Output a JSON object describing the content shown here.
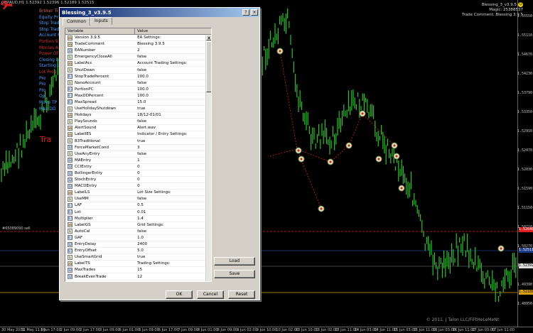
{
  "chart": {
    "symbol_header": "GBPAUD,H1  1.52392 1.52396 1.52189 1.52515",
    "ea_info": [
      "Blessing_3_v3.9.5",
      "Magic:   25388537",
      "Trade Comment: Blessing 3.9.5"
    ],
    "ticket_label": "#65089090 sell",
    "copyright": "© 2011, J Talon LLC/FiFtHeLeMeNt",
    "overlay_lines": [
      {
        "text": "Broker Ti",
        "color": "#d06060"
      },
      {
        "text": "Equity Pr",
        "color": "#40a0ff"
      },
      {
        "text": "Stop Trad",
        "color": "#40a0ff"
      },
      {
        "text": "Stop Trad",
        "color": "#40a0ff"
      },
      {
        "text": "Account P",
        "color": "#40a0ff"
      },
      {
        "text": "Portion B",
        "color": "#d03030"
      },
      {
        "text": "Monies A",
        "color": "#d03030"
      },
      {
        "text": "Power Of",
        "color": "#d03030"
      },
      {
        "text": "Closing Le",
        "color": "#40a0ff"
      },
      {
        "text": "Starting L",
        "color": "#40a0ff"
      },
      {
        "text": "Lot Prog",
        "color": "#d03030"
      },
      {
        "text": "Pro",
        "color": "#40a0ff"
      },
      {
        "text": "Pro",
        "color": "#40a0ff"
      },
      {
        "text": "Pro",
        "color": "#40a0ff"
      },
      {
        "text": "Op",
        "color": "#40a0ff"
      },
      {
        "text": "Move TP",
        "color": "#40a0ff"
      },
      {
        "text": "Max DD",
        "color": "#40a0ff"
      }
    ],
    "overlay_big": "Tra",
    "price_labels": [
      "1.55550",
      "1.55110",
      "1.54670",
      "1.54230",
      "1.53790",
      "1.53350",
      "1.52910",
      "1.52470",
      "1.52030",
      "1.51590",
      "1.51150",
      "1.50710",
      "1.50270",
      "1.49830",
      "1.49390",
      "1.48950"
    ],
    "price_tags": [
      {
        "text": "1.52640",
        "color": "#e02020",
        "fg": "#fff"
      },
      {
        "text": "1.52511",
        "color": "#1c3a8a",
        "fg": "#fff"
      },
      {
        "text": "1.52392",
        "color": "#dddddd",
        "fg": "#000"
      },
      {
        "text": "1.52189",
        "color": "#d6a010",
        "fg": "#000"
      }
    ],
    "time_labels": [
      "30 May 2011",
      "31 May 11:00",
      "1 Jun 17:00",
      "2 Jun 09:00",
      "2 Jun 17:00",
      "3 Jun 09:00",
      "6 Jun 01:00",
      "6 Jun 09:00",
      "6 Jun 17:00",
      "7 Jun 09:00",
      "8 Jun 01:00",
      "8 Jun 09:00",
      "9 Jun 02:00",
      "9 Jun 10:00",
      "10 Jun 02:00",
      "10 Jun 10:00",
      "13 Jun 02:00",
      "13 Jun 11:00",
      "14 Jun 03:00",
      "14 Jun 11:00",
      "15 Jun 03:00",
      "15 Jun 11:00",
      "16 Jun 03:00",
      "16 Jun 11:00",
      "17 Jun 03:00",
      "17 Jun 11:00"
    ]
  },
  "dialog": {
    "title": "Blessing_3_v3.9.5",
    "tabs": [
      "Common",
      "Inputs"
    ],
    "active_tab": 1,
    "columns": [
      "Variable",
      "Value"
    ],
    "rows": [
      {
        "name": "Version 3.9.5",
        "value": "EA Settings:",
        "type": "str"
      },
      {
        "name": "TradeComment",
        "value": "Blessing 3.9.5",
        "type": "str"
      },
      {
        "name": "EANumber",
        "value": "2",
        "type": "int"
      },
      {
        "name": "EmergencyCloseAll",
        "value": "false",
        "type": "bool"
      },
      {
        "name": "LabelAcc",
        "value": "Account Trading Settings:",
        "type": "str"
      },
      {
        "name": "ShutDown",
        "value": "false",
        "type": "bool"
      },
      {
        "name": "StopTradePercent",
        "value": "100.0",
        "type": "dbl"
      },
      {
        "name": "NanoAccount",
        "value": "false",
        "type": "bool"
      },
      {
        "name": "PortionPC",
        "value": "100.0",
        "type": "dbl"
      },
      {
        "name": "MaxDDPercent",
        "value": "100.0",
        "type": "dbl"
      },
      {
        "name": "MaxSpread",
        "value": "15.0",
        "type": "dbl"
      },
      {
        "name": "UseHolidayShutdown",
        "value": "true",
        "type": "bool"
      },
      {
        "name": "Holidays",
        "value": "18/12-01/01",
        "type": "str"
      },
      {
        "name": "PlaySounds",
        "value": "false",
        "type": "bool"
      },
      {
        "name": "AlertSound",
        "value": "Alert.wav",
        "type": "str"
      },
      {
        "name": "LabelIES",
        "value": "Indicator / Entry Settings:",
        "type": "str"
      },
      {
        "name": "B3Traditional",
        "value": "true",
        "type": "bool"
      },
      {
        "name": "ForceMarketCond",
        "value": "3",
        "type": "int"
      },
      {
        "name": "UseAnyEntry",
        "value": "false",
        "type": "bool"
      },
      {
        "name": "MAEntry",
        "value": "1",
        "type": "int"
      },
      {
        "name": "CCIEntry",
        "value": "0",
        "type": "int"
      },
      {
        "name": "BollingerEntry",
        "value": "0",
        "type": "int"
      },
      {
        "name": "StochEntry",
        "value": "0",
        "type": "int"
      },
      {
        "name": "MACDEntry",
        "value": "0",
        "type": "int"
      },
      {
        "name": "LabelLS",
        "value": "Lot Size Settings:",
        "type": "str"
      },
      {
        "name": "UseMM",
        "value": "false",
        "type": "bool"
      },
      {
        "name": "LAF",
        "value": "0.5",
        "type": "dbl"
      },
      {
        "name": "Lot",
        "value": "0.01",
        "type": "dbl"
      },
      {
        "name": "Multiplier",
        "value": "1.4",
        "type": "dbl"
      },
      {
        "name": "LabelGS",
        "value": "Grid Settings:",
        "type": "str"
      },
      {
        "name": "AutoCal",
        "value": "false",
        "type": "bool"
      },
      {
        "name": "GAF",
        "value": "1.0",
        "type": "dbl"
      },
      {
        "name": "EntryDelay",
        "value": "2400",
        "type": "int"
      },
      {
        "name": "EntryOffset",
        "value": "5.0",
        "type": "dbl"
      },
      {
        "name": "UseSmartGrid",
        "value": "true",
        "type": "bool"
      },
      {
        "name": "LabelTS",
        "value": "Trading Settings:",
        "type": "str"
      },
      {
        "name": "MaxTrades",
        "value": "15",
        "type": "int"
      },
      {
        "name": "BreakEvenTrade",
        "value": "12",
        "type": "int"
      }
    ],
    "buttons": {
      "load": "Load",
      "save": "Save",
      "ok": "OK",
      "cancel": "Cancel",
      "reset": "Reset"
    },
    "title_buttons": [
      "?",
      "×"
    ]
  },
  "colors": {
    "bull_candle": "#22c422",
    "bear_candle": "#22c422",
    "grid_red": "#e02020",
    "grid_blue": "#1c3a8a",
    "grid_orange": "#d6a010",
    "title_gradient_start": "#0a246a"
  }
}
